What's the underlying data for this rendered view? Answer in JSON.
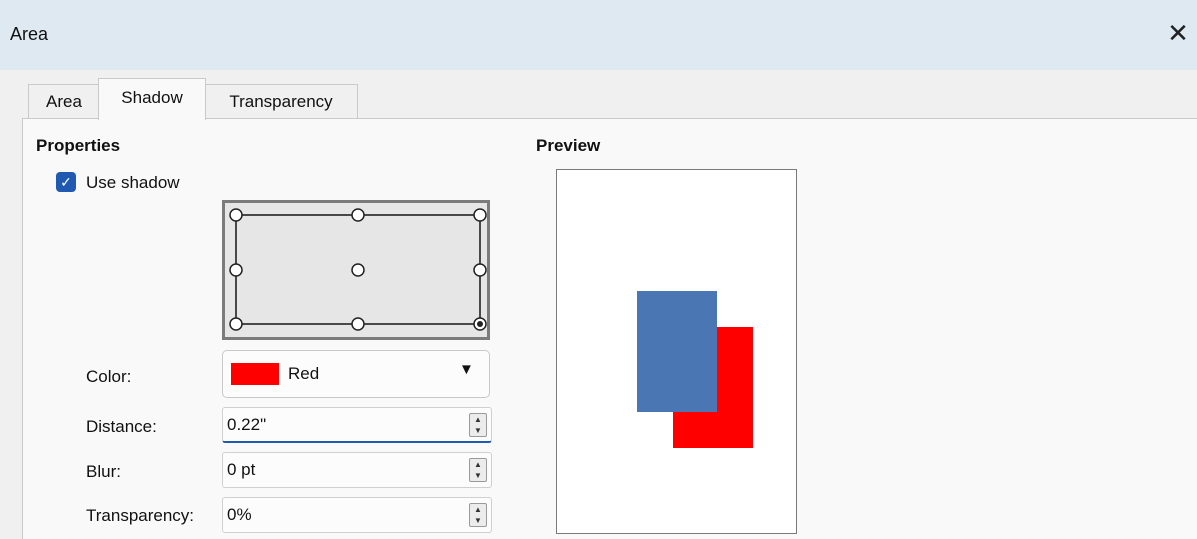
{
  "dialog": {
    "title": "Area",
    "close_icon": "close-icon"
  },
  "tabs": [
    {
      "label": "Area",
      "active": false
    },
    {
      "label": "Shadow",
      "active": true
    },
    {
      "label": "Transparency",
      "active": false
    }
  ],
  "properties": {
    "heading": "Properties",
    "use_shadow": {
      "label": "Use shadow",
      "checked": true
    },
    "position_grid": {
      "selected": "bottom-right"
    },
    "color": {
      "label": "Color:",
      "value": "Red",
      "swatch": "#ff0000"
    },
    "distance": {
      "label": "Distance:",
      "value": "0.22\""
    },
    "blur": {
      "label": "Blur:",
      "value": "0 pt"
    },
    "transparency": {
      "label": "Transparency:",
      "value": "0%"
    }
  },
  "preview": {
    "heading": "Preview",
    "object_color": "#4a76b3",
    "shadow_color": "#ff0000"
  }
}
